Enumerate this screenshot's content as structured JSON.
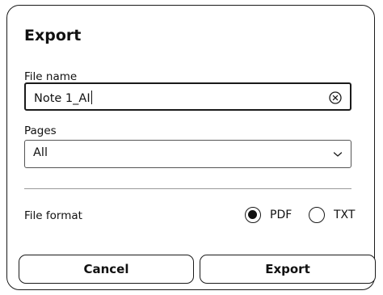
{
  "dialog": {
    "title": "Export",
    "file_name": {
      "label": "File name",
      "value": "Note 1_AI",
      "clear_icon": "clear-circle-x-icon"
    },
    "pages": {
      "label": "Pages",
      "selected": "All",
      "dropdown_icon": "chevron-down-icon"
    },
    "file_format": {
      "label": "File format",
      "options": [
        {
          "label": "PDF",
          "checked": true
        },
        {
          "label": "TXT",
          "checked": false
        }
      ]
    },
    "buttons": {
      "cancel": "Cancel",
      "export": "Export"
    }
  }
}
